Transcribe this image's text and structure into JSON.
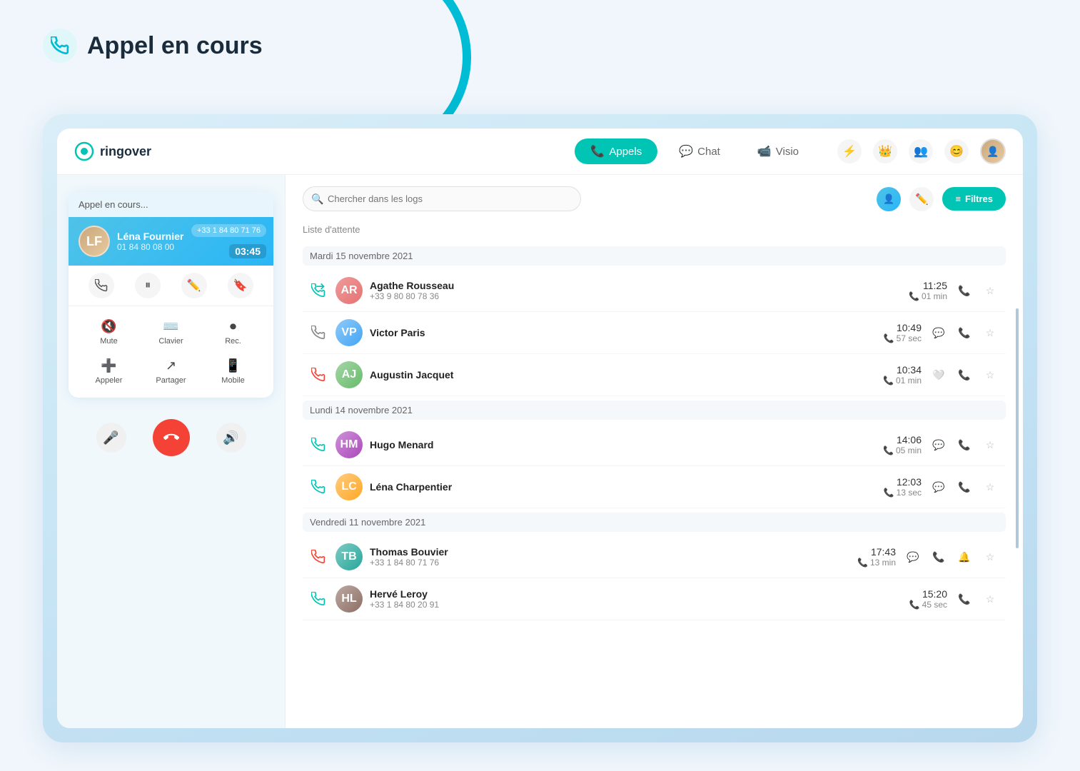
{
  "page": {
    "title": "Appel en cours"
  },
  "logo": {
    "text": "ringover"
  },
  "nav": {
    "tabs": [
      {
        "id": "appels",
        "label": "Appels",
        "icon": "📞",
        "active": true
      },
      {
        "id": "chat",
        "label": "Chat",
        "icon": "💬",
        "active": false
      },
      {
        "id": "visio",
        "label": "Visio",
        "icon": "📹",
        "active": false
      }
    ],
    "icons": [
      {
        "id": "lightning",
        "symbol": "⚡"
      },
      {
        "id": "crown",
        "symbol": "👑"
      },
      {
        "id": "team",
        "symbol": "👥"
      },
      {
        "id": "emoji",
        "symbol": "😊"
      }
    ]
  },
  "call_widget": {
    "header": "Appel en cours...",
    "user": {
      "name": "Léna Fournier",
      "phone": "01 84 80 08 00",
      "phone_badge": "+33 1 84 80 71 76",
      "timer": "03:45",
      "avatar_initials": "LF"
    },
    "action_buttons": [
      {
        "id": "callback",
        "icon": "📞"
      },
      {
        "id": "pause",
        "icon": "⏸"
      },
      {
        "id": "edit",
        "icon": "✏️"
      },
      {
        "id": "tag",
        "icon": "🔖"
      }
    ],
    "options": [
      {
        "id": "mute",
        "icon": "🔇",
        "label": "Mute"
      },
      {
        "id": "keyboard",
        "icon": "⌨️",
        "label": "Clavier"
      },
      {
        "id": "record",
        "icon": "⏺",
        "label": "Rec."
      },
      {
        "id": "add-call",
        "icon": "➕",
        "label": "Appeler"
      },
      {
        "id": "share",
        "icon": "↗",
        "label": "Partager"
      },
      {
        "id": "mobile",
        "icon": "📱",
        "label": "Mobile"
      }
    ],
    "controls": {
      "mute_icon": "🎤",
      "end_icon": "📵",
      "speaker_icon": "🔊"
    }
  },
  "search": {
    "placeholder": "Chercher dans les logs"
  },
  "filters": {
    "button_label": "Filtres",
    "filter_icon": "≡"
  },
  "wait_list": {
    "label": "Liste d'attente"
  },
  "call_logs": {
    "sections": [
      {
        "date": "Mardi 15 novembre 2021",
        "calls": [
          {
            "id": 1,
            "type": "outbound",
            "type_color": "#00c4b4",
            "contact_name": "Agathe Rousseau",
            "contact_phone": "+33 9 80 80 78 36",
            "time": "11:25",
            "duration": "01 min",
            "avatar_initials": "AR",
            "avatar_class": "avatar-ar",
            "has_sms": false,
            "has_callback": true,
            "has_star": true,
            "bell_active": false
          },
          {
            "id": 2,
            "type": "inbound",
            "type_color": "#888",
            "contact_name": "Victor Paris",
            "contact_phone": "",
            "time": "10:49",
            "duration": "57 sec",
            "avatar_initials": "VP",
            "avatar_class": "avatar-vp",
            "has_sms": true,
            "has_callback": true,
            "has_star": true,
            "bell_active": false
          },
          {
            "id": 3,
            "type": "missed",
            "type_color": "#f44336",
            "contact_name": "Augustin Jacquet",
            "contact_phone": "",
            "time": "10:34",
            "duration": "01 min",
            "avatar_initials": "AJ",
            "avatar_class": "avatar-aj",
            "has_sms": true,
            "has_callback": true,
            "has_star": true,
            "bell_active": false
          }
        ]
      },
      {
        "date": "Lundi 14 novembre 2021",
        "calls": [
          {
            "id": 4,
            "type": "outbound",
            "type_color": "#00c4b4",
            "contact_name": "Hugo Menard",
            "contact_phone": "",
            "time": "14:06",
            "duration": "05 min",
            "avatar_initials": "HM",
            "avatar_class": "avatar-hm",
            "has_sms": true,
            "has_callback": true,
            "has_star": true,
            "bell_active": false
          },
          {
            "id": 5,
            "type": "outbound",
            "type_color": "#00c4b4",
            "contact_name": "Léna Charpentier",
            "contact_phone": "",
            "time": "12:03",
            "duration": "13 sec",
            "avatar_initials": "LC",
            "avatar_class": "avatar-lc",
            "has_sms": true,
            "has_callback": true,
            "has_star": true,
            "bell_active": false
          }
        ]
      },
      {
        "date": "Vendredi 11 novembre 2021",
        "calls": [
          {
            "id": 6,
            "type": "missed",
            "type_color": "#f44336",
            "contact_name": "Thomas Bouvier",
            "contact_phone": "+33 1 84 80 71 76",
            "time": "17:43",
            "duration": "13 min",
            "avatar_initials": "TB",
            "avatar_class": "avatar-tb",
            "has_sms": true,
            "has_callback": true,
            "has_star": true,
            "bell_active": true
          },
          {
            "id": 7,
            "type": "outbound",
            "type_color": "#00c4b4",
            "contact_name": "Hervé Leroy",
            "contact_phone": "+33 1 84 80 20 91",
            "time": "15:20",
            "duration": "45 sec",
            "avatar_initials": "HL",
            "avatar_class": "avatar-hl",
            "has_sms": false,
            "has_callback": true,
            "has_star": true,
            "bell_active": false
          }
        ]
      }
    ]
  }
}
